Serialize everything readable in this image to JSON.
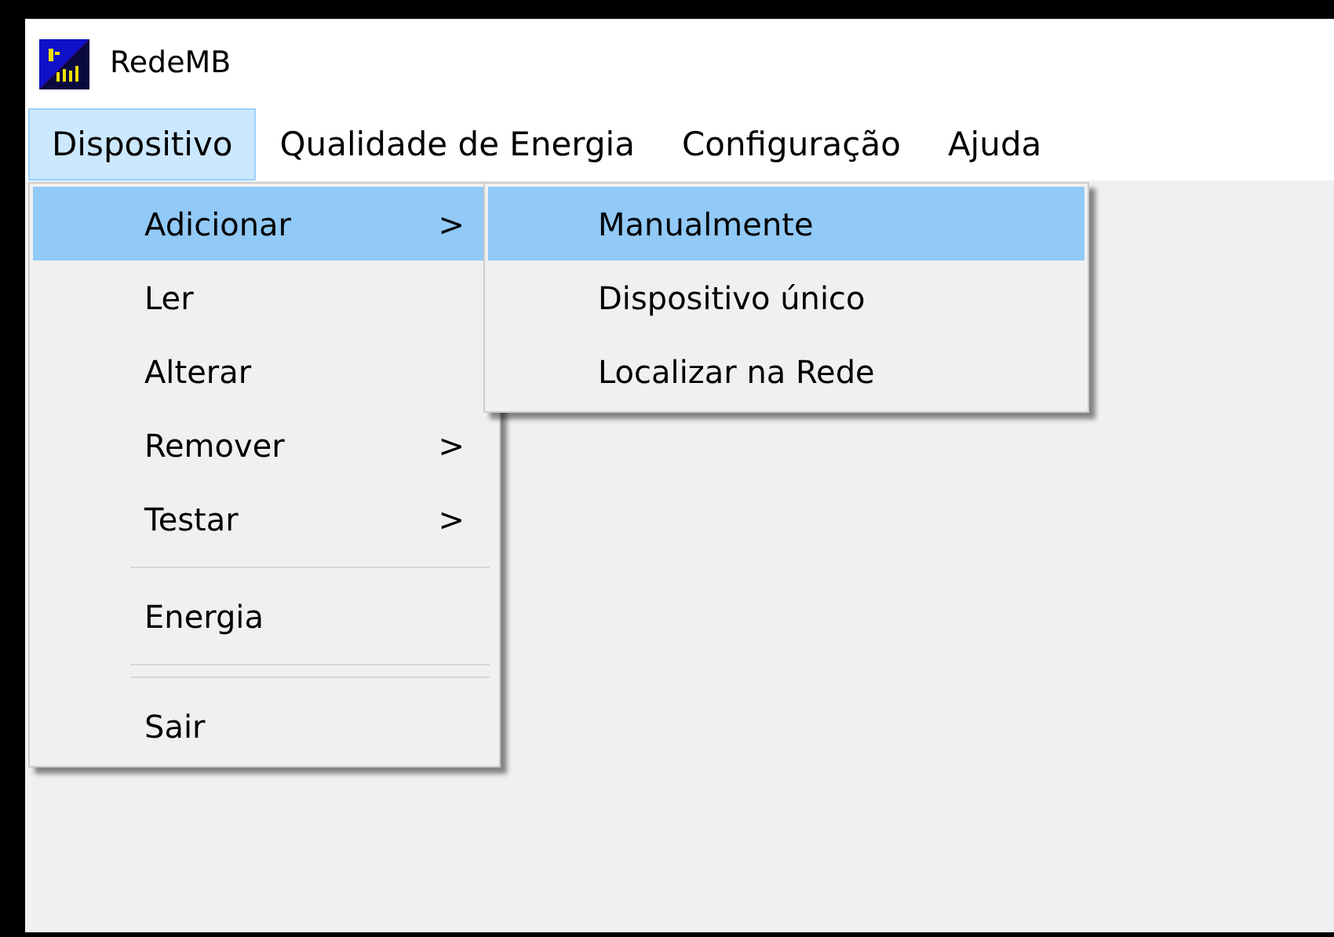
{
  "window": {
    "title": "RedeMB"
  },
  "menu_bar": [
    {
      "label": "Dispositivo",
      "selected": true
    },
    {
      "label": "Qualidade de Energia",
      "selected": false
    },
    {
      "label": "Configuração",
      "selected": false
    },
    {
      "label": "Ajuda",
      "selected": false
    }
  ],
  "dropdown": {
    "items": [
      {
        "kind": "item",
        "label": "Adicionar",
        "arrow": ">",
        "selected": true
      },
      {
        "kind": "item",
        "label": "Ler",
        "selected": false
      },
      {
        "kind": "item",
        "label": "Alterar",
        "selected": false
      },
      {
        "kind": "item",
        "label": "Remover",
        "arrow": ">",
        "selected": false
      },
      {
        "kind": "item",
        "label": "Testar",
        "arrow": ">",
        "selected": false
      },
      {
        "kind": "separator"
      },
      {
        "kind": "item",
        "label": "Energia",
        "selected": false
      },
      {
        "kind": "separator"
      },
      {
        "kind": "separator"
      },
      {
        "kind": "item",
        "label": "Sair",
        "selected": false
      }
    ]
  },
  "submenu": {
    "items": [
      {
        "kind": "item",
        "label": "Manualmente",
        "selected": true
      },
      {
        "kind": "item",
        "label": "Dispositivo único",
        "selected": false
      },
      {
        "kind": "item",
        "label": "Localizar na Rede",
        "selected": false
      }
    ]
  }
}
